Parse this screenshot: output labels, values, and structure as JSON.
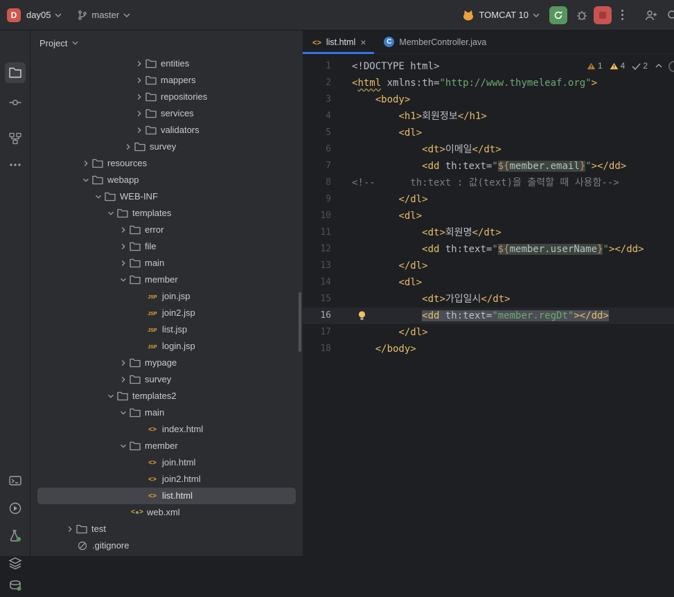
{
  "topbar": {
    "project_initial": "D",
    "project_name": "day05",
    "branch_name": "master",
    "run_config": "TOMCAT 10"
  },
  "left_rail": {
    "icons": [
      "project",
      "commit",
      "structure",
      "more-tools",
      "terminal",
      "services",
      "run-tests",
      "build-layers",
      "database"
    ]
  },
  "project_panel": {
    "title": "Project",
    "tree": [
      {
        "label": "entities",
        "icon": "folder",
        "state": "collapsed",
        "indent": 139
      },
      {
        "label": "mappers",
        "icon": "folder",
        "state": "collapsed",
        "indent": 139
      },
      {
        "label": "repositories",
        "icon": "folder",
        "state": "collapsed",
        "indent": 139
      },
      {
        "label": "services",
        "icon": "folder",
        "state": "collapsed",
        "indent": 139
      },
      {
        "label": "validators",
        "icon": "folder",
        "state": "collapsed",
        "indent": 139
      },
      {
        "label": "survey",
        "icon": "folder",
        "state": "collapsed",
        "indent": 123
      },
      {
        "label": "resources",
        "icon": "folder",
        "state": "collapsed",
        "indent": 62
      },
      {
        "label": "webapp",
        "icon": "folder",
        "state": "expanded",
        "indent": 62
      },
      {
        "label": "WEB-INF",
        "icon": "folder",
        "state": "expanded",
        "indent": 80
      },
      {
        "label": "templates",
        "icon": "folder",
        "state": "expanded",
        "indent": 98
      },
      {
        "label": "error",
        "icon": "folder",
        "state": "collapsed",
        "indent": 116
      },
      {
        "label": "file",
        "icon": "folder",
        "state": "collapsed",
        "indent": 116
      },
      {
        "label": "main",
        "icon": "folder",
        "state": "collapsed",
        "indent": 116
      },
      {
        "label": "member",
        "icon": "folder",
        "state": "expanded",
        "indent": 116
      },
      {
        "label": "join.jsp",
        "icon": "jsp",
        "indent": 141
      },
      {
        "label": "join2.jsp",
        "icon": "jsp",
        "indent": 141
      },
      {
        "label": "list.jsp",
        "icon": "jsp",
        "indent": 141
      },
      {
        "label": "login.jsp",
        "icon": "jsp",
        "indent": 141
      },
      {
        "label": "mypage",
        "icon": "folder",
        "state": "collapsed",
        "indent": 116
      },
      {
        "label": "survey",
        "icon": "folder",
        "state": "collapsed",
        "indent": 116
      },
      {
        "label": "templates2",
        "icon": "folder",
        "state": "expanded",
        "indent": 98
      },
      {
        "label": "main",
        "icon": "folder",
        "state": "expanded",
        "indent": 116
      },
      {
        "label": "index.html",
        "icon": "html",
        "indent": 141
      },
      {
        "label": "member",
        "icon": "folder",
        "state": "expanded",
        "indent": 116
      },
      {
        "label": "join.html",
        "icon": "html",
        "indent": 141
      },
      {
        "label": "join2.html",
        "icon": "html",
        "indent": 141
      },
      {
        "label": "list.html",
        "icon": "html",
        "indent": 141,
        "selected": true
      },
      {
        "label": "web.xml",
        "icon": "xml",
        "indent": 119
      },
      {
        "label": "test",
        "icon": "folder",
        "state": "collapsed",
        "indent": 39
      },
      {
        "label": ".gitignore",
        "icon": "gitignore",
        "indent": 40
      }
    ]
  },
  "editor": {
    "tabs": [
      {
        "label": "list.html",
        "icon": "html-file",
        "active": true
      },
      {
        "label": "MemberController.java",
        "icon": "java-class",
        "active": false
      }
    ],
    "inspections": {
      "errors": "1",
      "warnings": "4",
      "weak_warnings": "2"
    },
    "current_line": 16,
    "lines": [
      {
        "n": 1,
        "t": [
          [
            "p",
            "<!DOCTYPE html>"
          ]
        ]
      },
      {
        "n": 2,
        "t": [
          [
            "t",
            "<"
          ],
          [
            "tw",
            "html"
          ],
          [
            "p",
            " xmlns:th="
          ],
          [
            "s",
            "\"http://www.thymeleaf.org\""
          ],
          [
            "t",
            ">"
          ]
        ]
      },
      {
        "n": 3,
        "t": [
          [
            "p",
            "    "
          ],
          [
            "t",
            "<body>"
          ]
        ]
      },
      {
        "n": 4,
        "t": [
          [
            "p",
            "        "
          ],
          [
            "t",
            "<h1>"
          ],
          [
            "p",
            "회원정보"
          ],
          [
            "t",
            "</h1>"
          ]
        ]
      },
      {
        "n": 5,
        "t": [
          [
            "p",
            "        "
          ],
          [
            "t",
            "<dl>"
          ]
        ]
      },
      {
        "n": 6,
        "t": [
          [
            "p",
            "            "
          ],
          [
            "t",
            "<dt>"
          ],
          [
            "p",
            "이메일"
          ],
          [
            "t",
            "</dt>"
          ]
        ]
      },
      {
        "n": 7,
        "t": [
          [
            "p",
            "            "
          ],
          [
            "t",
            "<dd"
          ],
          [
            "p",
            " th:text="
          ],
          [
            "s",
            "\""
          ],
          [
            "eb",
            "${"
          ],
          [
            "e",
            "member.email"
          ],
          [
            "eb",
            "}"
          ],
          [
            "s",
            "\""
          ],
          [
            "t",
            "></dd>"
          ]
        ]
      },
      {
        "n": 8,
        "t": [
          [
            "c",
            "<!--      th:text : 값(text)을 출력할 때 사용함-->"
          ]
        ]
      },
      {
        "n": 9,
        "t": [
          [
            "p",
            "        "
          ],
          [
            "t",
            "</dl>"
          ]
        ]
      },
      {
        "n": 10,
        "t": [
          [
            "p",
            "        "
          ],
          [
            "t",
            "<dl>"
          ]
        ]
      },
      {
        "n": 11,
        "t": [
          [
            "p",
            "            "
          ],
          [
            "t",
            "<dt>"
          ],
          [
            "p",
            "회원명"
          ],
          [
            "t",
            "</dt>"
          ]
        ]
      },
      {
        "n": 12,
        "t": [
          [
            "p",
            "            "
          ],
          [
            "t",
            "<dd"
          ],
          [
            "p",
            " th:text="
          ],
          [
            "s",
            "\""
          ],
          [
            "eb",
            "${"
          ],
          [
            "e",
            "member.userName"
          ],
          [
            "eb",
            "}"
          ],
          [
            "s",
            "\""
          ],
          [
            "t",
            "></dd>"
          ]
        ]
      },
      {
        "n": 13,
        "t": [
          [
            "p",
            "        "
          ],
          [
            "t",
            "</dl>"
          ]
        ]
      },
      {
        "n": 14,
        "t": [
          [
            "p",
            "        "
          ],
          [
            "t",
            "<dl>"
          ]
        ]
      },
      {
        "n": 15,
        "t": [
          [
            "p",
            "            "
          ],
          [
            "t",
            "<dt>"
          ],
          [
            "p",
            "가입일시"
          ],
          [
            "t",
            "</dt>"
          ]
        ]
      },
      {
        "n": 16,
        "t": [
          [
            "p",
            "            "
          ],
          [
            "t",
            "<dd",
            1
          ],
          [
            "p",
            " th:text=",
            1
          ],
          [
            "s",
            "\"member.regDt\"",
            1
          ],
          [
            "t",
            "></dd>",
            1
          ]
        ]
      },
      {
        "n": 17,
        "t": [
          [
            "p",
            "        "
          ],
          [
            "t",
            "</dl>"
          ]
        ]
      },
      {
        "n": 18,
        "t": [
          [
            "p",
            "    "
          ],
          [
            "t",
            "</body>"
          ]
        ]
      }
    ]
  },
  "colors": {
    "accent_blue": "#3574F0",
    "run_green": "#57965C",
    "stop_red": "#C75450",
    "warning_yellow": "#F2C55C",
    "tag_yellow": "#E8BF6A",
    "string_green": "#6AAB73",
    "selection_gray": "#43454A"
  }
}
